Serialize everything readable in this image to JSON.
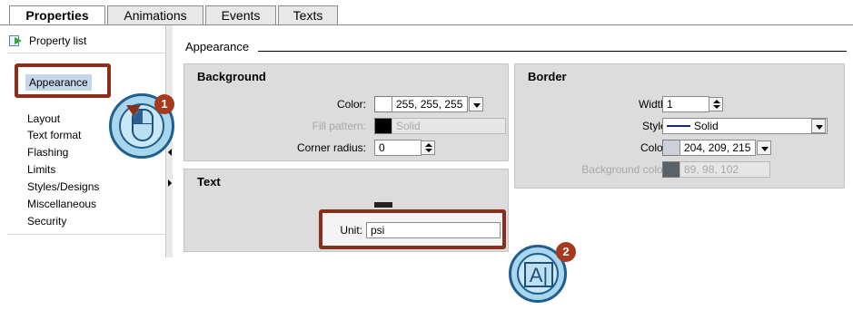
{
  "tabs": [
    "Properties",
    "Animations",
    "Events",
    "Texts"
  ],
  "left_panel": {
    "property_list": "Property list",
    "selected": "Appearance",
    "items": [
      "Layout",
      "Text format",
      "Flashing",
      "Limits",
      "Styles/Designs",
      "Miscellaneous",
      "Security"
    ]
  },
  "content": {
    "section_title": "Appearance",
    "background": {
      "title": "Background",
      "color_label": "Color:",
      "color_value": "255, 255, 255",
      "color_swatch": "#ffffff",
      "fill_pattern_label": "Fill pattern:",
      "fill_pattern_value": "Solid",
      "fill_pattern_swatch": "#000000",
      "corner_radius_label": "Corner radius:",
      "corner_radius_value": "0"
    },
    "text": {
      "title": "Text",
      "unit_label": "Unit:",
      "unit_value": "psi"
    },
    "border": {
      "title": "Border",
      "width_label": "Width:",
      "width_value": "1",
      "style_label": "Style:",
      "style_value": "Solid",
      "color_label": "Color:",
      "color_value": "204, 209, 215",
      "color_swatch": "#ccd1d7",
      "bg_color_label": "Background color:",
      "bg_color_value": "89, 98, 102",
      "bg_color_swatch": "#596266"
    }
  },
  "callouts": {
    "badge_1": "1",
    "badge_2": "2",
    "ai_glyph": "A|"
  }
}
